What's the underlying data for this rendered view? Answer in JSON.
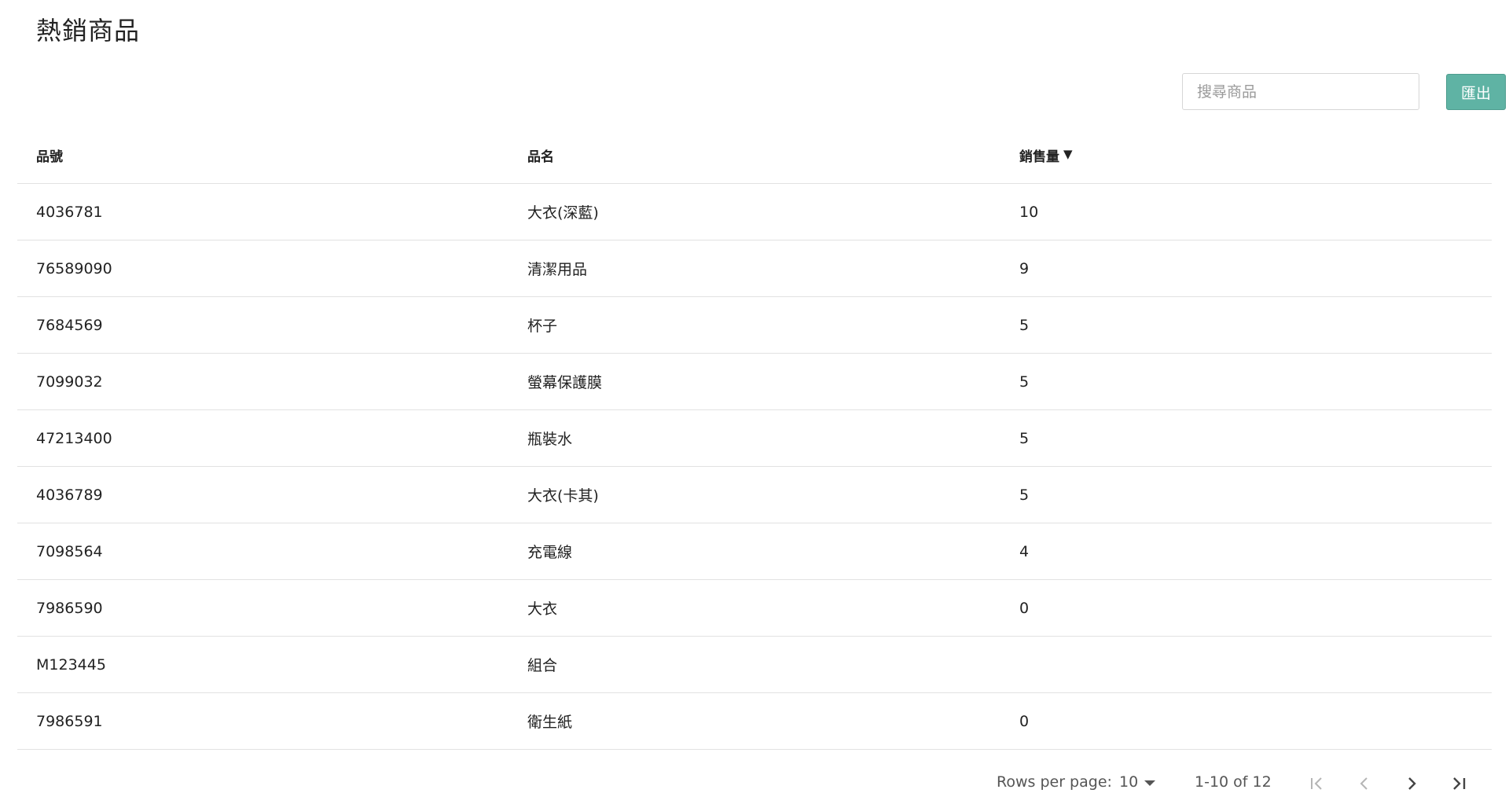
{
  "page": {
    "title": "熱銷商品"
  },
  "toolbar": {
    "search_placeholder": "搜尋商品",
    "export_label": "匯出"
  },
  "table": {
    "columns": [
      "品號",
      "品名",
      "銷售量"
    ],
    "sort_indicator": "▼",
    "rows": [
      [
        "4036781",
        "大衣(深藍)",
        "10"
      ],
      [
        "76589090",
        "清潔用品",
        "9"
      ],
      [
        "7684569",
        "杯子",
        "5"
      ],
      [
        "7099032",
        "螢幕保護膜",
        "5"
      ],
      [
        "47213400",
        "瓶裝水",
        "5"
      ],
      [
        "4036789",
        "大衣(卡其)",
        "5"
      ],
      [
        "7098564",
        "充電線",
        "4"
      ],
      [
        "7986590",
        "大衣",
        "0"
      ],
      [
        "M123445",
        "組合",
        ""
      ],
      [
        "7986591",
        "衛生紙",
        "0"
      ]
    ]
  },
  "pagination": {
    "rows_per_page_label": "Rows per page:",
    "rows_per_page_value": "10",
    "range_text": "1-10 of 12"
  },
  "colors": {
    "accent": "#5fb3a4",
    "divider": "#e2e2e2"
  }
}
